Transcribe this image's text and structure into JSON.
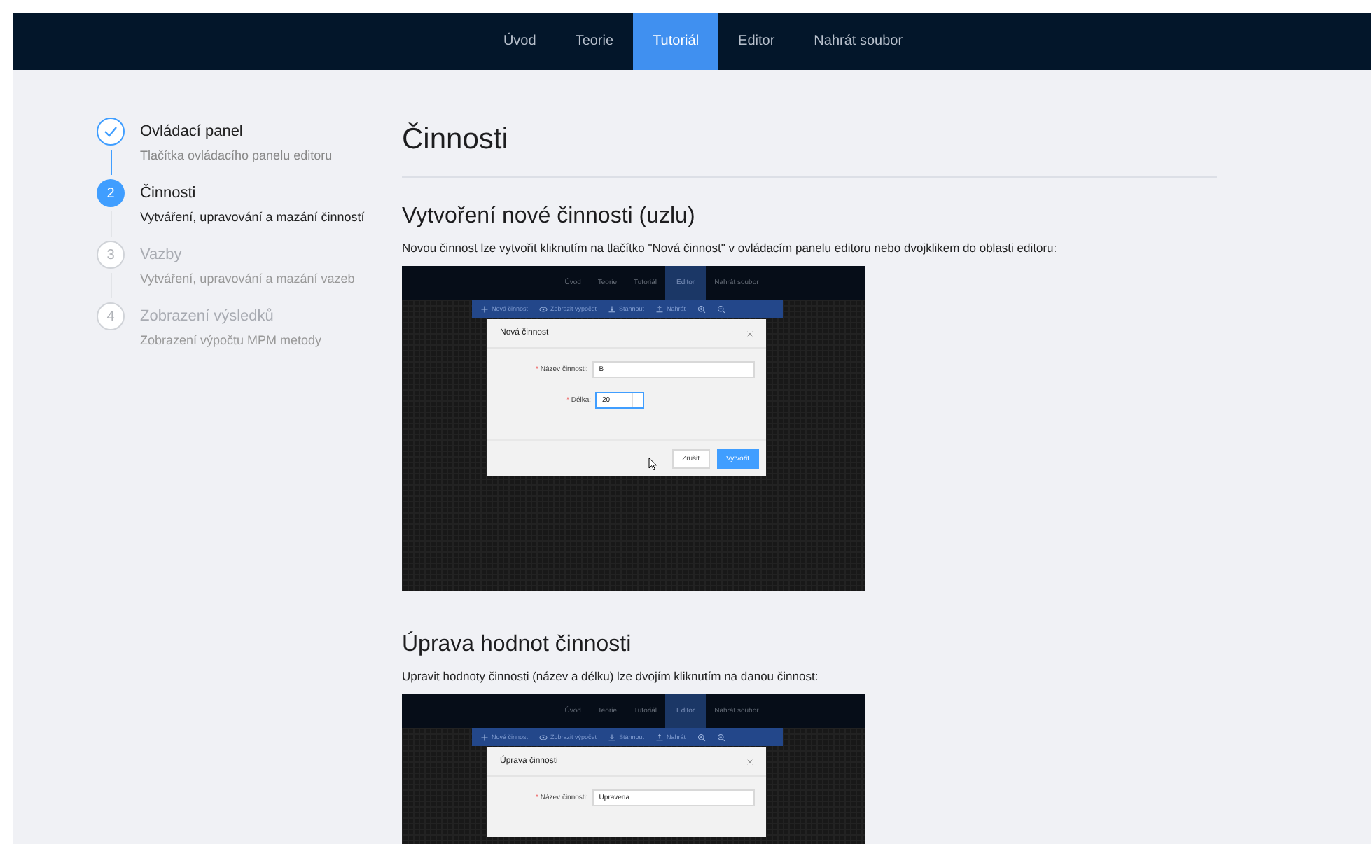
{
  "nav": [
    {
      "label": "Úvod",
      "selected": false
    },
    {
      "label": "Teorie",
      "selected": false
    },
    {
      "label": "Tutoriál",
      "selected": true
    },
    {
      "label": "Editor",
      "selected": false
    },
    {
      "label": "Nahrát soubor",
      "selected": false
    }
  ],
  "steps": [
    {
      "kind": "finish",
      "title": "Ovládací panel",
      "description": "Tlačítka ovládacího panelu editoru"
    },
    {
      "kind": "process",
      "number": "2",
      "title": "Činnosti",
      "description": "Vytváření, upravování a mazání činností"
    },
    {
      "kind": "wait",
      "number": "3",
      "title": "Vazby",
      "description": "Vytváření, upravování a mazání vazeb"
    },
    {
      "kind": "wait",
      "number": "4",
      "title": "Zobrazení výsledků",
      "description": "Zobrazení výpočtu MPM metody"
    }
  ],
  "title": "Činnosti",
  "sections": [
    {
      "heading": "Vytvoření nové činnosti (uzlu)",
      "text": "Novou činnost lze vytvořit kliknutím na tlačítko \"Nová činnost\" v ovládacím panelu editoru nebo dvojklikem do oblasti editoru:",
      "screenshot": {
        "nav": [
          {
            "label": "Úvod",
            "selected": false
          },
          {
            "label": "Teorie",
            "selected": false
          },
          {
            "label": "Tutoriál",
            "selected": false
          },
          {
            "label": "Editor",
            "selected": true
          },
          {
            "label": "Nahrát soubor",
            "selected": false
          }
        ],
        "toolbar": [
          {
            "kind": "plus",
            "label": "Nová činnost"
          },
          {
            "kind": "eye",
            "label": "Zobrazit výpočet"
          },
          {
            "kind": "download",
            "label": "Stáhnout"
          },
          {
            "kind": "upload",
            "label": "Nahrát"
          },
          {
            "kind": "zoom-in"
          },
          {
            "kind": "zoom-out"
          }
        ],
        "dialog": {
          "title": "Nová činnost",
          "fields": [
            {
              "kind": "text",
              "mark": "*",
              "label": "Název činnosti:",
              "value": "B"
            },
            {
              "kind": "number",
              "mark": "*",
              "label": "Délka:",
              "value": "20"
            }
          ],
          "buttons": [
            {
              "label": "Zrušit",
              "primary": false
            },
            {
              "label": "Vytvořit",
              "primary": true
            }
          ]
        }
      }
    },
    {
      "heading": "Úprava hodnot činnosti",
      "text": "Upravit hodnoty činnosti (název a délku) lze dvojím kliknutím na danou činnost:",
      "screenshot": {
        "nav": [
          {
            "label": "Úvod",
            "selected": false
          },
          {
            "label": "Teorie",
            "selected": false
          },
          {
            "label": "Tutoriál",
            "selected": false
          },
          {
            "label": "Editor",
            "selected": true
          },
          {
            "label": "Nahrát soubor",
            "selected": false
          }
        ],
        "toolbar": [
          {
            "kind": "plus",
            "label": "Nová činnost"
          },
          {
            "kind": "eye",
            "label": "Zobrazit výpočet"
          },
          {
            "kind": "download",
            "label": "Stáhnout"
          },
          {
            "kind": "upload",
            "label": "Nahrát"
          },
          {
            "kind": "zoom-in"
          },
          {
            "kind": "zoom-out"
          }
        ],
        "dialog": {
          "title": "Úprava činnosti",
          "fields": [
            {
              "kind": "text",
              "mark": "*",
              "label": "Název činnosti:",
              "value": "Upravena"
            }
          ]
        }
      }
    }
  ]
}
